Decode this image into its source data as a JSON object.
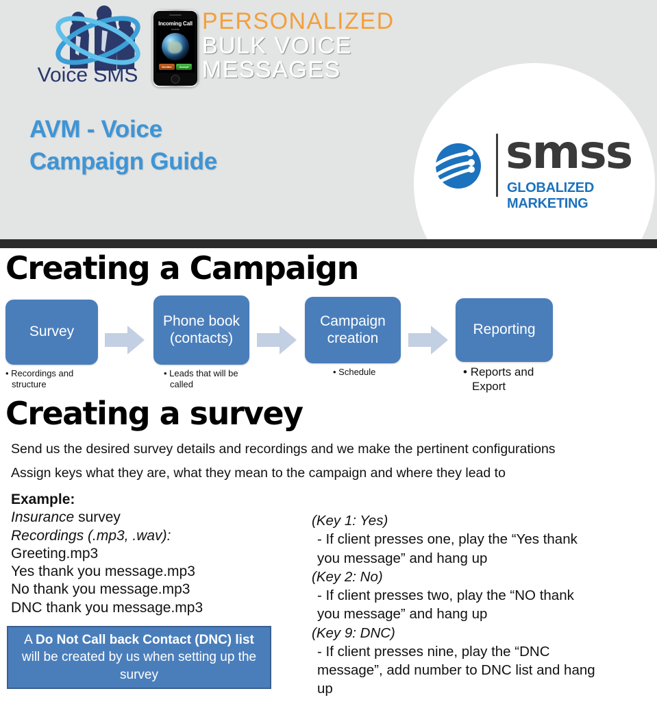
{
  "header": {
    "brand_logo_text": "Voice SMS",
    "phone": {
      "incoming_label": "Incoming Call",
      "caller_sub": "mobile",
      "decline_label": "Decline",
      "accept_label": "Accept"
    },
    "tagline": {
      "line1": "PERSONALIZED",
      "line2": "BULK VOICE",
      "line3": "MESSAGES",
      "line1_color": "#f2a03c",
      "line2_color": "#ffffff"
    },
    "title_line1": "AVM - Voice",
    "title_line2": "Campaign Guide",
    "title_color": "#3d95d6",
    "partner_logo": {
      "word": "smss",
      "tagline": "GLOBALIZED MARKETING",
      "mark_color": "#1c72bd",
      "word_color": "#3a3a3a"
    },
    "background_color": "#e3e4e4"
  },
  "divider_color": "#2b2b2b",
  "campaign_section": {
    "title": "Creating a Campaign",
    "box_color": "#4a7ebb",
    "arrow_color": "#c3cfe2",
    "steps": [
      {
        "label": "Survey",
        "caption": "Recordings and structure"
      },
      {
        "label": "Phone book (contacts)",
        "caption": "Leads that will be called"
      },
      {
        "label": "Campaign creation",
        "caption": "Schedule"
      },
      {
        "label": "Reporting",
        "caption": "Reports and Export"
      }
    ]
  },
  "survey_section": {
    "title": "Creating a survey",
    "intro_line1": "Send us the desired survey details and recordings and we make the pertinent configurations",
    "intro_line2": "Assign keys what they are, what they mean to the campaign and where they lead to",
    "example": {
      "heading": "Example:",
      "subject_italic": "Insurance",
      "subject_rest": " survey",
      "recordings_label": "Recordings (.mp3, .wav):",
      "files": [
        "Greeting.mp3",
        "Yes thank you message.mp3",
        "No thank you message.mp3",
        "DNC thank you message.mp3"
      ]
    },
    "dnc_note": {
      "prefix": "A ",
      "bold1": "Do Not Call back Contact (DNC) list",
      "rest": " will be created by us when setting up the survey",
      "background": "#4a7ebb",
      "border": "#3a5f8f"
    },
    "keys": [
      {
        "head": "(Key 1: Yes)",
        "desc": "- If client presses one, play the “Yes thank you message” and hang up"
      },
      {
        "head": "(Key 2: No)",
        "desc": "- If client presses two, play the “NO thank you message” and hang up"
      },
      {
        "head": "(Key 9: DNC)",
        "desc": "- If client presses nine, play the “DNC message”, add number to DNC list and hang up"
      }
    ]
  }
}
